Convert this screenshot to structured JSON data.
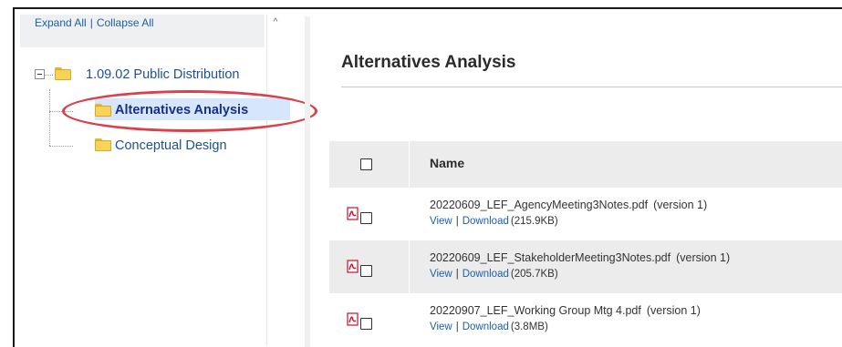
{
  "tree_toolbar": {
    "expand_all": "Expand All",
    "separator": "|",
    "collapse_all": "Collapse All"
  },
  "scrollbar": {
    "up_glyph": "^"
  },
  "tree": {
    "root": {
      "label": "1.09.02 Public Distribution",
      "icon": "folder-icon",
      "expander": "minus"
    },
    "children": [
      {
        "label": "Alternatives Analysis",
        "icon": "folder-icon",
        "selected": true
      },
      {
        "label": "Conceptual Design",
        "icon": "folder-icon",
        "selected": false
      }
    ]
  },
  "main": {
    "title": "Alternatives Analysis",
    "table": {
      "column_name": "Name",
      "rows": [
        {
          "file": "20220609_LEF_AgencyMeeting3Notes.pdf",
          "version": "(version 1)",
          "view": "View",
          "sep": "|",
          "download": "Download",
          "size": "(215.9KB)",
          "icon": "pdf-icon"
        },
        {
          "file": "20220609_LEF_StakeholderMeeting3Notes.pdf",
          "version": "(version 1)",
          "view": "View",
          "sep": "|",
          "download": "Download",
          "size": "(205.7KB)",
          "icon": "pdf-icon"
        },
        {
          "file": "20220907_LEF_Working Group Mtg 4.pdf",
          "version": "(version 1)",
          "view": "View",
          "sep": "|",
          "download": "Download",
          "size": "(3.8MB)",
          "icon": "pdf-icon"
        }
      ]
    }
  },
  "colors": {
    "link": "#1e5fa8",
    "selected_bg": "#d7e7fb",
    "highlight_ring": "#d9414c",
    "header_bg": "#ececec",
    "folder": "#f7d35a",
    "pdf_red": "#c8102e"
  }
}
